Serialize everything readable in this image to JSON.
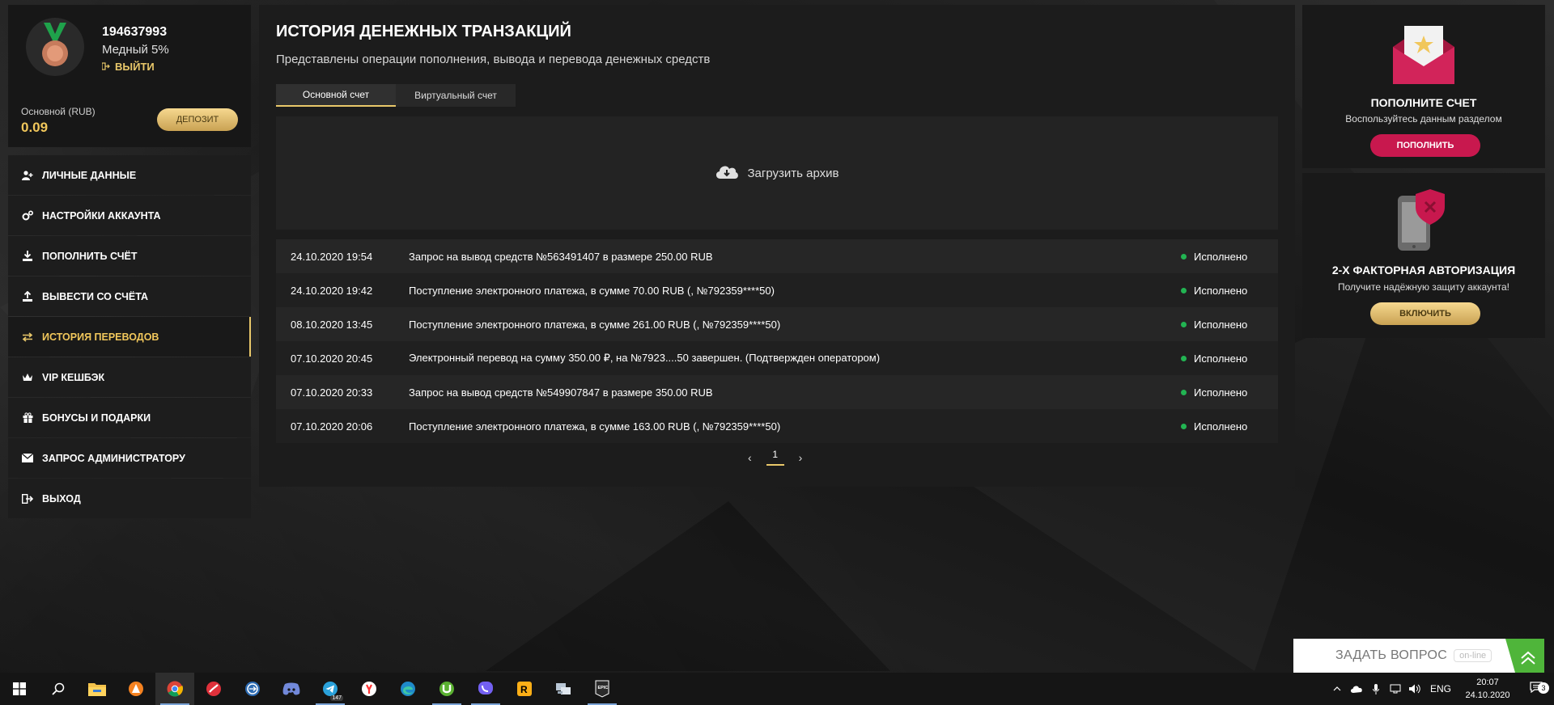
{
  "profile": {
    "user_id": "194637993",
    "level": "Медный 5%",
    "logout_label": "ВЫЙТИ",
    "balance_label": "Основной (RUB)",
    "balance_value": "0.09",
    "deposit_label": "ДЕПОЗИТ"
  },
  "menu": {
    "items": [
      {
        "label": "ЛИЧНЫЕ ДАННЫЕ",
        "icon": "user-plus-icon"
      },
      {
        "label": "НАСТРОЙКИ АККАУНТА",
        "icon": "gears-icon"
      },
      {
        "label": "ПОПОЛНИТЬ СЧЁТ",
        "icon": "download-icon"
      },
      {
        "label": "ВЫВЕСТИ СО СЧЁТА",
        "icon": "upload-icon"
      },
      {
        "label": "ИСТОРИЯ ПЕРЕВОДОВ",
        "icon": "exchange-icon",
        "active": true
      },
      {
        "label": "VIP КЕШБЭК",
        "icon": "crown-icon"
      },
      {
        "label": "БОНУСЫ И ПОДАРКИ",
        "icon": "gift-icon"
      },
      {
        "label": "ЗАПРОС АДМИНИСТРАТОРУ",
        "icon": "envelope-icon"
      },
      {
        "label": "ВЫХОД",
        "icon": "sign-out-icon"
      }
    ]
  },
  "main": {
    "title": "ИСТОРИЯ ДЕНЕЖНЫХ ТРАНЗАКЦИЙ",
    "subtitle": "Представлены операции пополнения, вывода и перевода денежных средств",
    "tabs": [
      {
        "label": "Основной счет",
        "active": true
      },
      {
        "label": "Виртуальный счет",
        "active": false
      }
    ],
    "archive_label": "Загрузить архив",
    "transactions": [
      {
        "date": "24.10.2020 19:54",
        "description": "Запрос на вывод средств №563491407 в размере 250.00 RUB",
        "status": "Исполнено"
      },
      {
        "date": "24.10.2020 19:42",
        "description": "Поступление электронного платежа, в сумме 70.00 RUB (, №792359****50)",
        "status": "Исполнено"
      },
      {
        "date": "08.10.2020 13:45",
        "description": "Поступление электронного платежа, в сумме 261.00 RUB (, №792359****50)",
        "status": "Исполнено"
      },
      {
        "date": "07.10.2020 20:45",
        "description": "Электронный перевод на сумму 350.00 ₽, на №7923....50 завершен. (Подтвержден оператором)",
        "status": "Исполнено"
      },
      {
        "date": "07.10.2020 20:33",
        "description": "Запрос на вывод средств №549907847 в размере 350.00 RUB",
        "status": "Исполнено"
      },
      {
        "date": "07.10.2020 20:06",
        "description": "Поступление электронного платежа, в сумме 163.00 RUB (, №792359****50)",
        "status": "Исполнено"
      }
    ],
    "pager": {
      "prev": "‹",
      "current": "1",
      "next": "›"
    }
  },
  "promo_deposit": {
    "title": "ПОПОЛНИТЕ СЧЕТ",
    "text": "Воспользуйтесь данным разделом",
    "button": "ПОПОЛНИТЬ"
  },
  "promo_2fa": {
    "title": "2-Х ФАКТОРНАЯ АВТОРИЗАЦИЯ",
    "text": "Получите надёжную защиту аккаунта!",
    "button": "ВКЛЮЧИТЬ"
  },
  "ask": {
    "label": "ЗАДАТЬ ВОПРОС",
    "status": "on-line"
  },
  "taskbar": {
    "apps": [
      "start-icon",
      "search-icon",
      "file-explorer-icon",
      "avast-icon",
      "chrome-icon",
      "opera-icon",
      "teamviewer-icon",
      "discord-icon",
      "telegram-icon",
      "yandex-browser-icon",
      "edge-icon",
      "utorrent-icon",
      "viber-icon",
      "rockstar-icon",
      "network-app-icon",
      "epic-games-icon"
    ],
    "telegram_badge": "147",
    "lang": "ENG",
    "time": "20:07",
    "date": "24.10.2020",
    "notifications": "3"
  },
  "colors": {
    "accent_gold": "#e9c86a",
    "pink": "#c8184e",
    "success": "#22b452"
  }
}
